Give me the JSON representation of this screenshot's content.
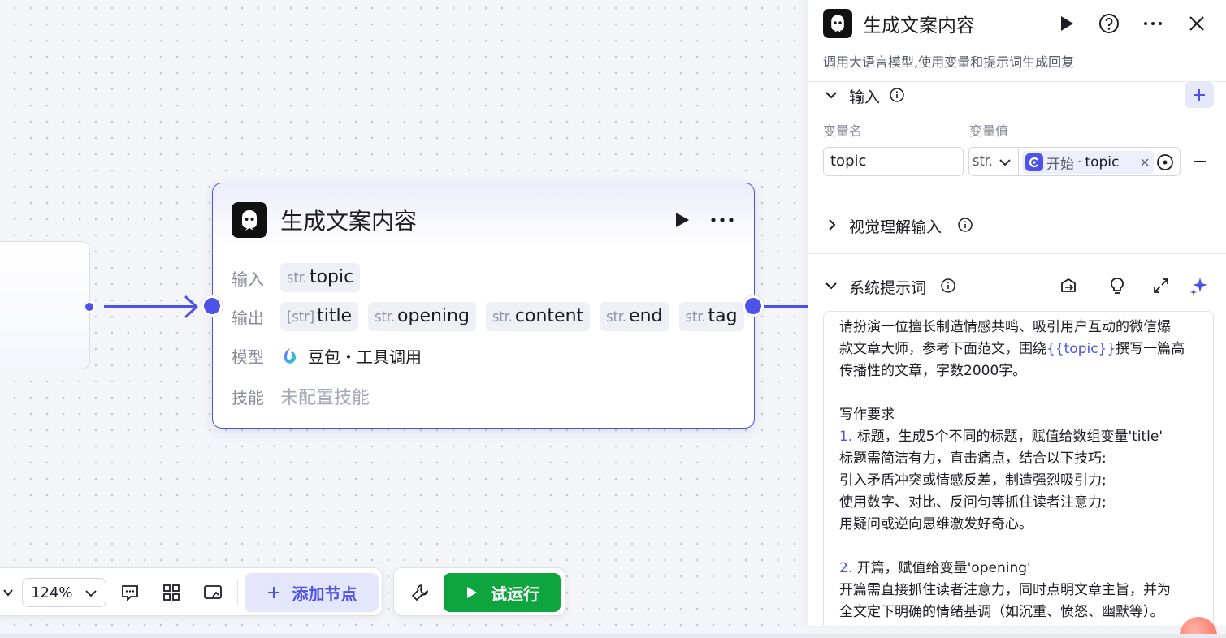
{
  "node": {
    "title": "生成文案内容",
    "labels": {
      "input": "输入",
      "output": "输出",
      "model": "模型",
      "skill": "技能"
    },
    "inputs": [
      {
        "type": "str.",
        "name": "topic"
      }
    ],
    "outputs": [
      {
        "type": "[str]",
        "name": "title"
      },
      {
        "type": "str.",
        "name": "opening"
      },
      {
        "type": "str.",
        "name": "content"
      },
      {
        "type": "str.",
        "name": "end"
      },
      {
        "type": "str.",
        "name": "tag"
      }
    ],
    "model": "豆包・工具调用",
    "skill_empty": "未配置技能"
  },
  "toolbar": {
    "zoom": "124%",
    "add_node": "添加节点",
    "run": "试运行"
  },
  "panel": {
    "title": "生成文案内容",
    "description": "调用大语言模型,使用变量和提示词生成回复",
    "input_section": {
      "title": "输入",
      "col_name": "变量名",
      "col_value": "变量值",
      "var_name": "topic",
      "var_type": "str.",
      "ref_source": "开始",
      "ref_sep": "·",
      "ref_var": "topic"
    },
    "vision_section": {
      "title": "视觉理解输入"
    },
    "system_prompt_section": {
      "title": "系统提示词"
    },
    "prompt": {
      "l1": "请扮演一位擅长制造情感共鸣、吸引用户互动的微信爆",
      "l2a": "款文章大师，参考下面范文，围绕",
      "l2var": "{{topic}}",
      "l2b": "撰写一篇高",
      "l3": "传播性的文章，字数2000字。",
      "l5": "写作要求",
      "l6num": "1.",
      "l6": " 标题，生成5个不同的标题，赋值给数组变量'title'",
      "l7": "标题需简洁有力，直击痛点，结合以下技巧:",
      "l8": "引入矛盾冲突或情感反差，制造强烈吸引力;",
      "l9": "使用数字、对比、反问句等抓住读者注意力;",
      "l10": "用疑问或逆向思维激发好奇心。",
      "l12num": "2.",
      "l12": " 开篇，赋值给变量'opening'",
      "l13": "开篇需直接抓住读者注意力，同时点明文章主旨，并为",
      "l14": "全文定下明确的情绪基调（如沉重、愤怒、幽默等）。"
    }
  },
  "colors": {
    "accent": "#4d53e8",
    "run": "#0ea53e"
  },
  "icons": [
    "bot-logo-icon",
    "play-icon",
    "more-icon",
    "help-icon",
    "close-icon",
    "chevron-down-icon",
    "chevron-right-icon",
    "info-icon",
    "plus-icon",
    "minus-icon",
    "clear-icon",
    "target-icon",
    "library-icon",
    "bulb-icon",
    "expand-icon",
    "sparkle-icon",
    "comment-icon",
    "grid-icon",
    "minimap-icon",
    "wrench-icon"
  ]
}
